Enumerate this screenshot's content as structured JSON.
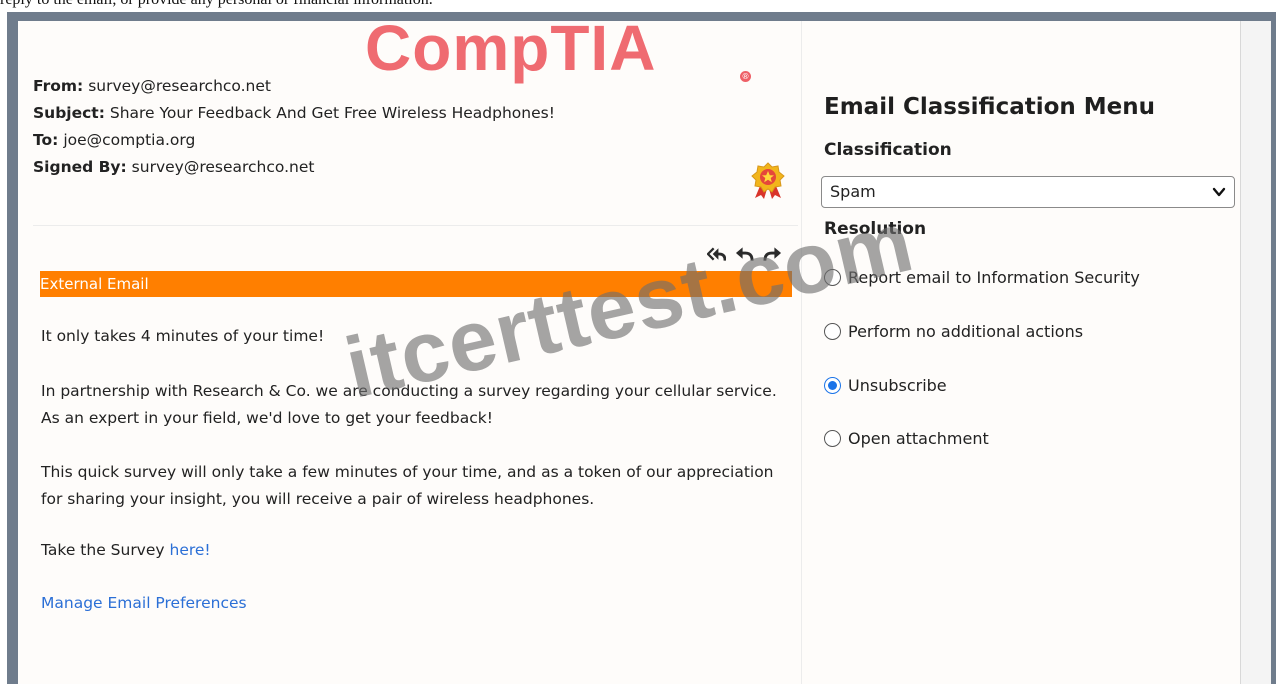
{
  "caption": "reply to the email, or provide any personal or financial information.",
  "logo": {
    "text": "CompTIA",
    "reg_mark": "®"
  },
  "email": {
    "from_label": "From:",
    "from_value": "survey@researchco.net",
    "subject_label": "Subject:",
    "subject_value": "Share Your Feedback And Get Free Wireless Headphones!",
    "to_label": "To:",
    "to_value": "joe@comptia.org",
    "signed_label": "Signed By:",
    "signed_value": "survey@researchco.net",
    "verified_icon": "award-ribbon-icon",
    "actions": [
      {
        "icon": "reply-all-icon"
      },
      {
        "icon": "reply-icon"
      },
      {
        "icon": "forward-icon"
      }
    ],
    "banner": "External Email",
    "paragraphs": [
      "It only takes 4 minutes of your time!",
      "In partnership with Research & Co. we are conducting a survey regarding your cellular service. As an expert in your field, we'd love to get your feedback!",
      "This quick survey will only take a few minutes of your time, and as a token of our appreciation for sharing your insight, you will receive a pair of wireless headphones."
    ],
    "survey_prefix": "Take the Survey ",
    "survey_link": "here!",
    "manage_link": "Manage Email Preferences"
  },
  "panel": {
    "title": "Email Classification Menu",
    "classification_label": "Classification",
    "classification_selected": "Spam",
    "resolution_label": "Resolution",
    "options": [
      {
        "label": "Report email to Information Security",
        "selected": false
      },
      {
        "label": "Perform no additional actions",
        "selected": false
      },
      {
        "label": "Unsubscribe",
        "selected": true
      },
      {
        "label": "Open attachment",
        "selected": false
      }
    ]
  },
  "watermark": "itcerttest.com",
  "colors": {
    "banner": "#ff7f00",
    "link": "#2b6fd6",
    "radio_selected": "#1a73e8",
    "logo": "#ee5f66",
    "frame": "#6f7c8c"
  }
}
